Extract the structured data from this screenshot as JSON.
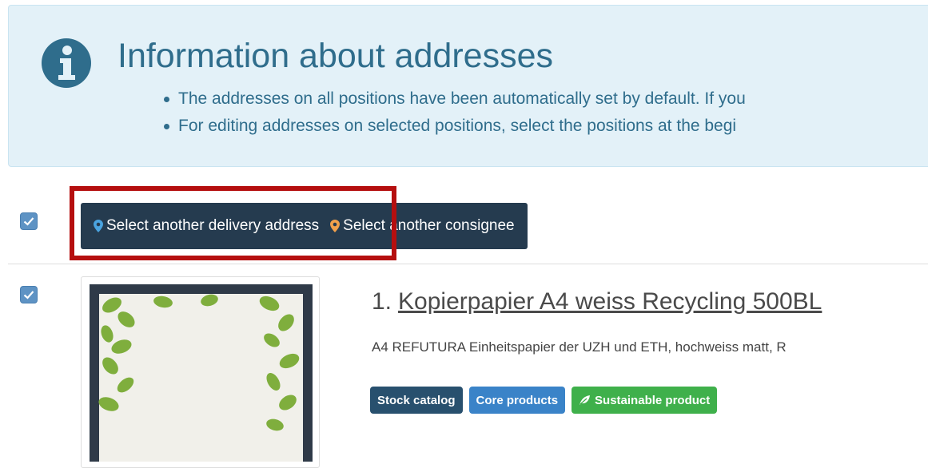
{
  "info": {
    "icon": "info-circle-icon",
    "title": "Information about addresses",
    "bullets": [
      "The addresses on all positions have been automatically set by default. If you",
      "For editing addresses on selected positions, select the positions at the begi"
    ]
  },
  "toolbar": {
    "select_all_checked": true,
    "delivery_address_icon": "map-marker-icon",
    "delivery_address_label": "Select another delivery address",
    "consignee_icon": "map-marker-icon",
    "consignee_label": "Select another consignee"
  },
  "colors": {
    "info_background": "#e3f1f8",
    "info_text": "#2f6d8c",
    "toolbar_background": "#253b4f",
    "delivery_icon": "#4aa3df",
    "consignee_icon": "#f0a04b",
    "highlight_border": "#b50f0f",
    "badge_stock": "#28506e",
    "badge_core": "#3a83c8",
    "badge_sustainable": "#3fb04b"
  },
  "products": [
    {
      "checked": true,
      "number": "1.",
      "name": "Kopierpapier A4 weiss Recycling 500BL",
      "description": "A4 REFUTURA Einheitspapier der UZH und ETH, hochweiss matt, R",
      "badges": [
        {
          "label": "Stock catalog"
        },
        {
          "label": "Core products"
        },
        {
          "label": "Sustainable product",
          "icon": "leaf-icon"
        }
      ]
    }
  ]
}
